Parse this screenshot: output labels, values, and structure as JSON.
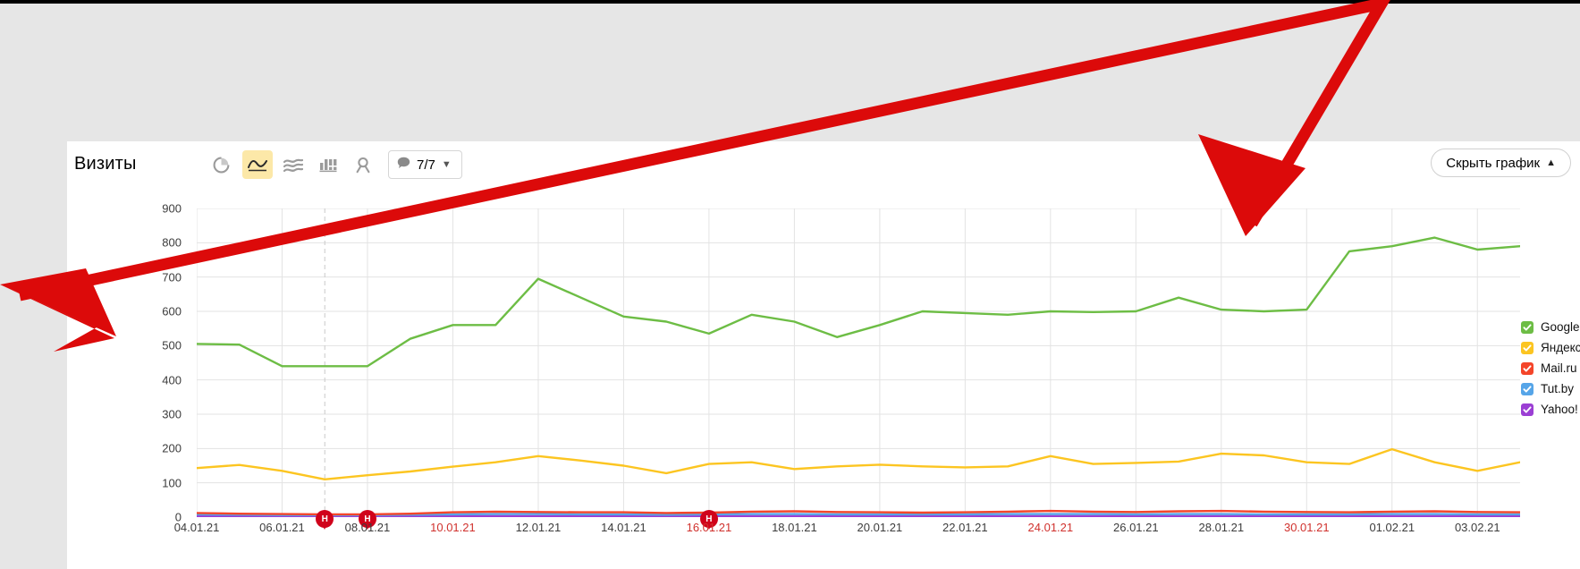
{
  "panel": {
    "metric_title": "Визиты",
    "hide_chart_label": "Скрыть график",
    "hide_chart_chevron": "chevron-up-icon",
    "comment_chip": {
      "icon": "comment-bubble-icon",
      "count_label": "7/7",
      "chevron": "chevron-down-icon"
    },
    "viz_buttons": [
      {
        "name": "pie-chart-view",
        "icon": "pie-chart-icon",
        "selected": false
      },
      {
        "name": "line-chart-view",
        "icon": "line-chart-icon",
        "selected": true
      },
      {
        "name": "area-chart-view",
        "icon": "area-chart-icon",
        "selected": false
      },
      {
        "name": "bar-chart-view",
        "icon": "bar-chart-icon",
        "selected": false
      },
      {
        "name": "map-view",
        "icon": "map-pin-icon",
        "selected": false
      }
    ]
  },
  "legend": {
    "items": [
      {
        "label": "Google",
        "color": "#6dbd45",
        "checked": true
      },
      {
        "label": "Яндекс",
        "color": "#fcc521",
        "checked": true
      },
      {
        "label": "Mail.ru",
        "color": "#f4452a",
        "checked": true
      },
      {
        "label": "Tut.by",
        "color": "#56a5e8",
        "checked": true
      },
      {
        "label": "Yahoo!",
        "color": "#9b3fd4",
        "checked": true
      }
    ]
  },
  "annotations": {
    "holiday_markers": [
      {
        "label": "Н",
        "date": "07.01.21"
      },
      {
        "label": "Н",
        "date": "08.01.21"
      },
      {
        "label": "Н",
        "date": "16.01.21"
      }
    ],
    "red_arrow": {
      "color": "#dc0a0a",
      "description": "hand-drawn-red-arrow"
    }
  },
  "chart_data": {
    "type": "line",
    "title": "Визиты",
    "xlabel": "",
    "ylabel": "",
    "ylim": [
      0,
      900
    ],
    "yticks": [
      0,
      100,
      200,
      300,
      400,
      500,
      600,
      700,
      800,
      900
    ],
    "grid": true,
    "legend_position": "right",
    "x": [
      "04.01.21",
      "05.01.21",
      "06.01.21",
      "07.01.21",
      "08.01.21",
      "09.01.21",
      "10.01.21",
      "11.01.21",
      "12.01.21",
      "13.01.21",
      "14.01.21",
      "15.01.21",
      "16.01.21",
      "17.01.21",
      "18.01.21",
      "19.01.21",
      "20.01.21",
      "21.01.21",
      "22.01.21",
      "23.01.21",
      "24.01.21",
      "25.01.21",
      "26.01.21",
      "27.01.21",
      "28.01.21",
      "29.01.21",
      "30.01.21",
      "31.01.21",
      "01.02.21",
      "02.02.21",
      "03.02.21",
      "04.02.21"
    ],
    "xtick_labels": [
      {
        "label": "04.01.21",
        "weekend": false
      },
      {
        "label": "06.01.21",
        "weekend": false
      },
      {
        "label": "08.01.21",
        "weekend": false
      },
      {
        "label": "10.01.21",
        "weekend": true
      },
      {
        "label": "12.01.21",
        "weekend": false
      },
      {
        "label": "14.01.21",
        "weekend": false
      },
      {
        "label": "16.01.21",
        "weekend": true
      },
      {
        "label": "18.01.21",
        "weekend": false
      },
      {
        "label": "20.01.21",
        "weekend": false
      },
      {
        "label": "22.01.21",
        "weekend": false
      },
      {
        "label": "24.01.21",
        "weekend": true
      },
      {
        "label": "26.01.21",
        "weekend": false
      },
      {
        "label": "28.01.21",
        "weekend": false
      },
      {
        "label": "30.01.21",
        "weekend": true
      },
      {
        "label": "01.02.21",
        "weekend": false
      },
      {
        "label": "03.02.21",
        "weekend": false
      }
    ],
    "series": [
      {
        "name": "Google",
        "color": "#6dbd45",
        "values": [
          505,
          503,
          440,
          440,
          440,
          520,
          560,
          560,
          695,
          640,
          585,
          570,
          535,
          590,
          570,
          525,
          560,
          600,
          595,
          590,
          600,
          598,
          600,
          640,
          605,
          600,
          605,
          775,
          790,
          815,
          780,
          790
        ]
      },
      {
        "name": "Яндекс",
        "color": "#fcc521",
        "values": [
          143,
          152,
          135,
          110,
          122,
          133,
          147,
          160,
          178,
          165,
          150,
          128,
          155,
          160,
          140,
          148,
          153,
          148,
          145,
          148,
          178,
          155,
          158,
          162,
          185,
          180,
          160,
          155,
          198,
          160,
          135,
          160
        ]
      },
      {
        "name": "Mail.ru",
        "color": "#f4452a",
        "values": [
          12,
          10,
          9,
          8,
          8,
          10,
          14,
          16,
          15,
          14,
          14,
          12,
          13,
          16,
          17,
          15,
          14,
          13,
          14,
          16,
          18,
          16,
          15,
          17,
          18,
          16,
          15,
          14,
          16,
          17,
          15,
          14
        ]
      },
      {
        "name": "Tut.by",
        "color": "#56a5e8",
        "values": [
          8,
          7,
          6,
          6,
          6,
          7,
          8,
          9,
          9,
          8,
          8,
          7,
          8,
          9,
          9,
          8,
          8,
          8,
          8,
          9,
          9,
          9,
          8,
          9,
          9,
          8,
          8,
          8,
          9,
          9,
          8,
          8
        ]
      },
      {
        "name": "Yahoo!",
        "color": "#9b3fd4",
        "values": [
          3,
          3,
          2,
          2,
          2,
          3,
          3,
          3,
          3,
          3,
          3,
          2,
          3,
          3,
          3,
          3,
          3,
          3,
          3,
          3,
          3,
          3,
          3,
          3,
          3,
          3,
          3,
          3,
          3,
          3,
          3,
          3
        ]
      }
    ]
  }
}
